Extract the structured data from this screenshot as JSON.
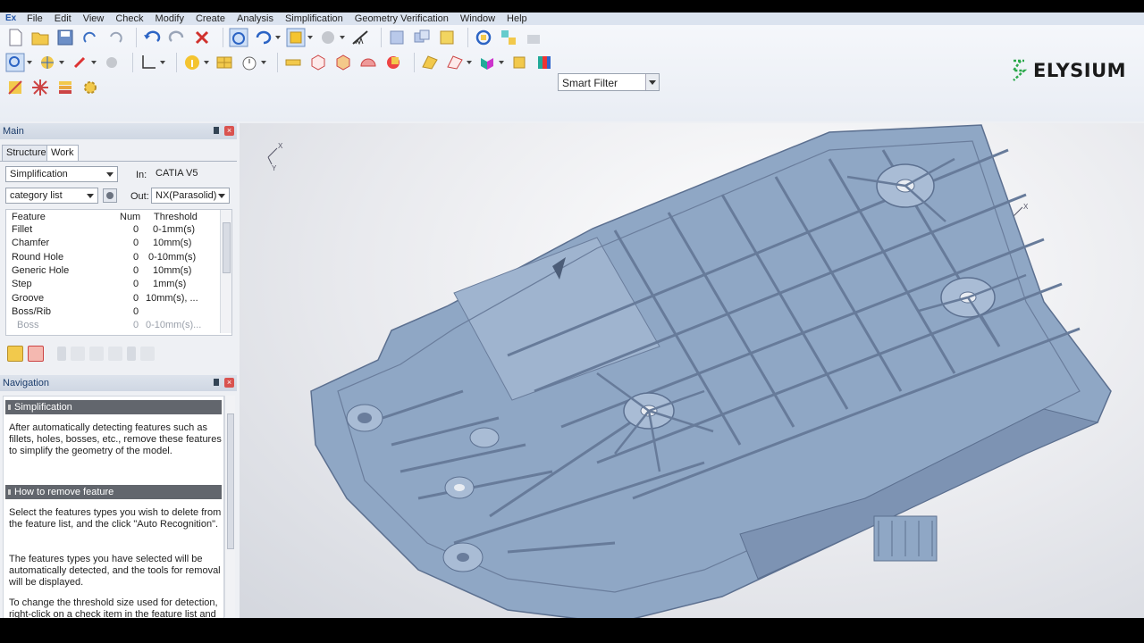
{
  "app": {
    "logo_letters": "Ex"
  },
  "menubar": {
    "items": [
      "File",
      "Edit",
      "View",
      "Check",
      "Modify",
      "Create",
      "Analysis",
      "Simplification",
      "Geometry Verification",
      "Window",
      "Help"
    ]
  },
  "toolbar": {
    "smart_filter": "Smart Filter"
  },
  "brand": {
    "name": "ELYSIUM",
    "color": "#2aa84a"
  },
  "main_panel": {
    "title": "Main",
    "tabs": [
      "Structure",
      "Work"
    ],
    "mode_select": "Simplification",
    "in_label": "In:",
    "in_value": "CATIA V5",
    "list_select": "category list",
    "out_label": "Out:",
    "out_value": "NX(Parasolid)",
    "columns": [
      "Feature",
      "Num",
      "Threshold"
    ],
    "rows": [
      {
        "feature": "Fillet",
        "num": "0",
        "threshold": "0-1mm(s)"
      },
      {
        "feature": "Chamfer",
        "num": "0",
        "threshold": "10mm(s)"
      },
      {
        "feature": "Round Hole",
        "num": "0",
        "threshold": "0-10mm(s)"
      },
      {
        "feature": "Generic Hole",
        "num": "0",
        "threshold": "10mm(s)"
      },
      {
        "feature": "Step",
        "num": "0",
        "threshold": "1mm(s)"
      },
      {
        "feature": "Groove",
        "num": "0",
        "threshold": "10mm(s), ..."
      },
      {
        "feature": "Boss/Rib",
        "num": "0",
        "threshold": ""
      },
      {
        "feature": "Boss",
        "num": "0",
        "threshold": "0-10mm(s)..."
      }
    ]
  },
  "navigation": {
    "title": "Navigation",
    "section1_title": "Simplification",
    "section1_text": "After automatically detecting features such as fillets, holes, bosses, etc., remove these features to simplify the geometry of the model.",
    "section2_title": "How to remove feature",
    "para1": "Select the features types you wish to delete from the feature list, and the click \"Auto Recognition\".",
    "para2": "The features types you have selected will be automatically detected, and the tools for removal will be displayed.",
    "para3": "To change the threshold size used for detection, right-click on a check item in the feature list and select \"Change threshold\""
  },
  "viewport": {
    "axis_x": "X",
    "axis_y": "Y",
    "model_color": "#8ea6c4"
  }
}
